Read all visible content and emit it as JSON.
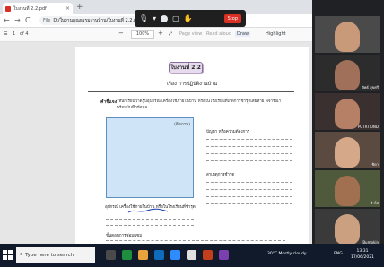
{
  "browser": {
    "tab_title": "ใบงานที่ 2.2.pdf",
    "tab_close": "×",
    "new_tab": "+",
    "url_label": "File",
    "url": "D:/ใบงานคุณธรรมงานบ้าน/ใบงานที่ 2.2.pdf",
    "nav_back": "←",
    "nav_forward": "→",
    "nav_reload": "C"
  },
  "meeting_bar": {
    "stop_label": "Stop"
  },
  "pdf_toolbar": {
    "page": "1",
    "page_total": "of 4",
    "minus": "−",
    "plus": "+",
    "zoom": "100%",
    "draw": "Draw",
    "highlight": "Highlight",
    "read_aloud": "Read aloud",
    "page_view": "Page view",
    "fit": "⤢"
  },
  "document": {
    "worksheet_title": "ใบงานที่ 2.2",
    "topic": "เรื่อง การปฏิบัติงานบ้าน",
    "instruction_label": "คำชี้แจง",
    "instruction_text": "ให้นักเรียนวาดรูปอุปกรณ์ เครื่องใช้ภายในบ้าน หรือในโรงเรียนที่เกิดการชำรุดเสียหาย พิจารณา พร้อมบันทึกข้อมูล",
    "draw_hint": "(ติดภาพ)",
    "equipment_label": "อุปกรณ์ เครื่องใช้ภายในบ้าน หรือในโรงเรียนที่ชำรุด",
    "problem_label": "ปัญหา หรือความต้องการ",
    "cause_label": "สาเหตุการชำรุด",
    "steps_label": "ขั้นตอนการซ่อมแซม"
  },
  "video_tiles": [
    {
      "name": "",
      "bg": "#4a4a4a",
      "face": "#c99a7a"
    },
    {
      "name": "ลัพธ์ สุขศรี",
      "bg": "#2c2c2c",
      "face": "#a0705a"
    },
    {
      "name": "PUTRTIOND",
      "bg": "#3b3030",
      "face": "#b58066"
    },
    {
      "name": "ชิดา",
      "bg": "#5a4a40",
      "face": "#d6a88a"
    },
    {
      "name": "ฟ้าใส",
      "bg": "#4f5a3c",
      "face": "#a07050"
    },
    {
      "name": "Bumpkin",
      "bg": "#3a3a3a",
      "face": "#caa080"
    }
  ],
  "taskbar": {
    "search_placeholder": "Type here to search",
    "weather": "30°C  Mostly cloudy",
    "language": "ENG",
    "time": "13:31",
    "date": "17/06/2021"
  },
  "colors": {
    "draw_box_fill": "#cfe4f7",
    "worksheet_button": "#e6dced",
    "meet_stop": "#d93025"
  }
}
